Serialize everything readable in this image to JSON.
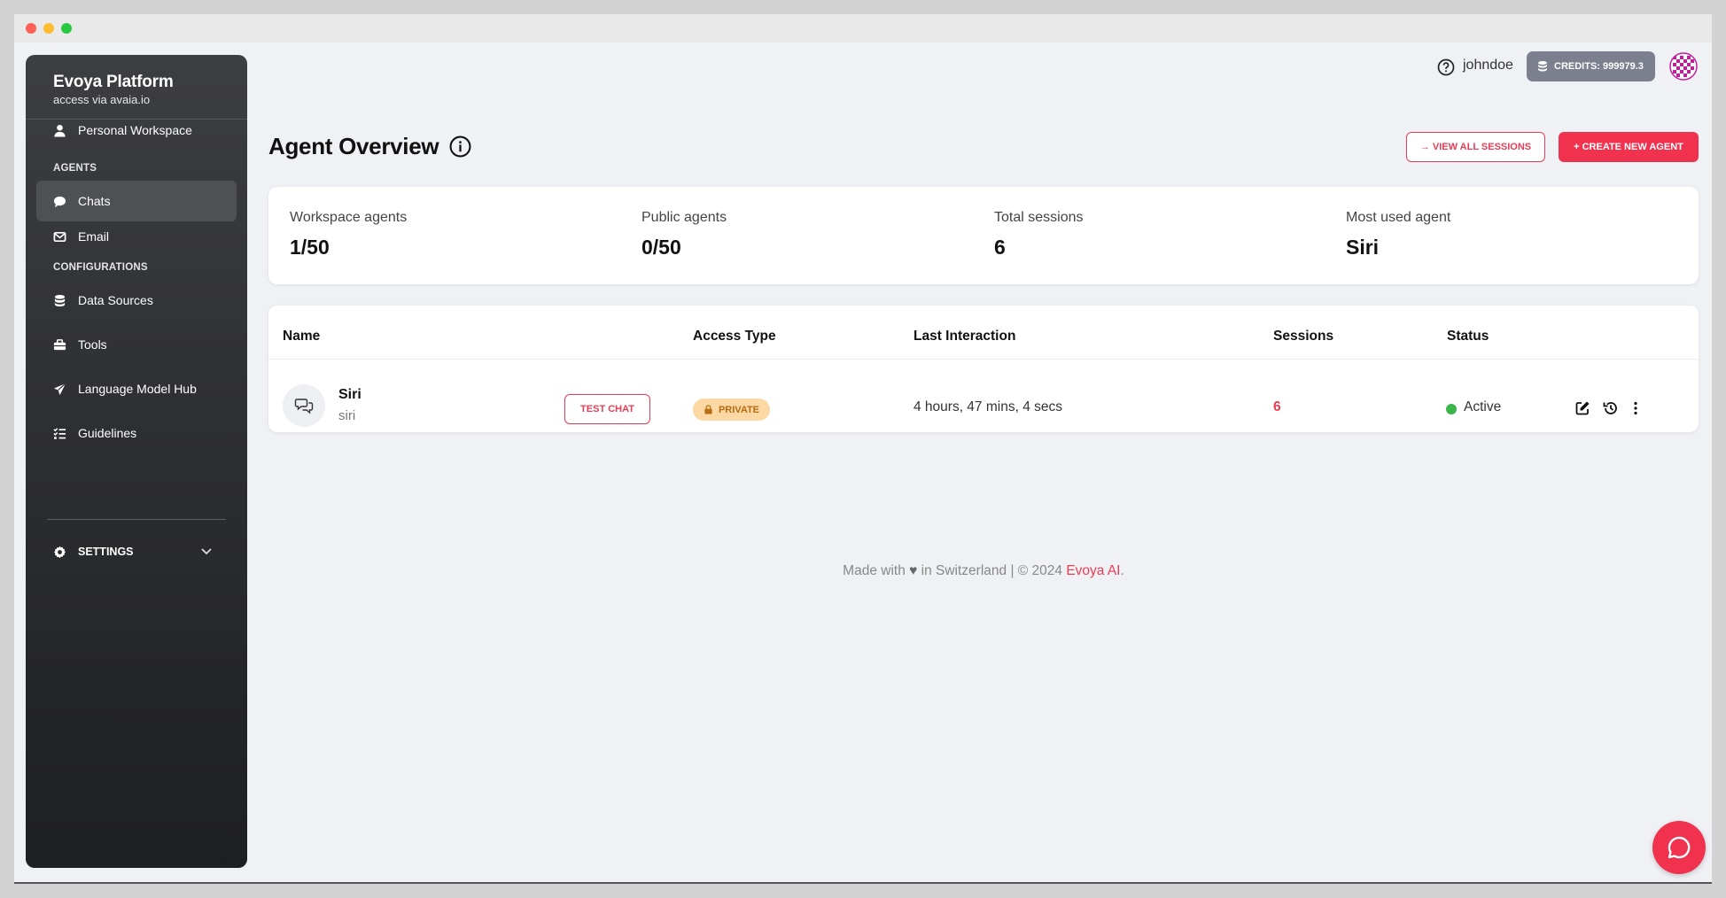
{
  "brand": {
    "title": "Evoya Platform",
    "subtitle": "access via avaia.io"
  },
  "sidebar": {
    "personal": "Personal Workspace",
    "agents_heading": "AGENTS",
    "chats": "Chats",
    "email": "Email",
    "config_heading": "CONFIGURATIONS",
    "data_sources": "Data Sources",
    "tools": "Tools",
    "language_model_hub": "Language Model Hub",
    "guidelines": "Guidelines",
    "settings": "SETTINGS"
  },
  "header": {
    "username": "johndoe",
    "credits": "CREDITS: 999979.3"
  },
  "page": {
    "title": "Agent Overview",
    "view_all_sessions": "→ VIEW ALL SESSIONS",
    "create_new_agent": "+ CREATE NEW AGENT"
  },
  "stats": [
    {
      "label": "Workspace agents",
      "value": "1/50"
    },
    {
      "label": "Public agents",
      "value": "0/50"
    },
    {
      "label": "Total sessions",
      "value": "6"
    },
    {
      "label": "Most used agent",
      "value": "Siri"
    }
  ],
  "table": {
    "headers": {
      "name": "Name",
      "access_type": "Access Type",
      "last_interaction": "Last Interaction",
      "sessions": "Sessions",
      "status": "Status"
    },
    "rows": [
      {
        "name": "Siri",
        "slug": "siri",
        "test_chat": "TEST CHAT",
        "access": "PRIVATE",
        "last_interaction": "4 hours, 47 mins, 4 secs",
        "sessions": "6",
        "status": "Active"
      }
    ]
  },
  "footer": {
    "prefix": "Made with",
    "suffix": "in Switzerland | © 2024",
    "brand": "Evoya AI",
    "end": "."
  },
  "colors": {
    "accent": "#f0324f",
    "sidebar": "#2b2c2f",
    "status_active": "#3cb54a",
    "badge_private": "#fbd8a4"
  }
}
